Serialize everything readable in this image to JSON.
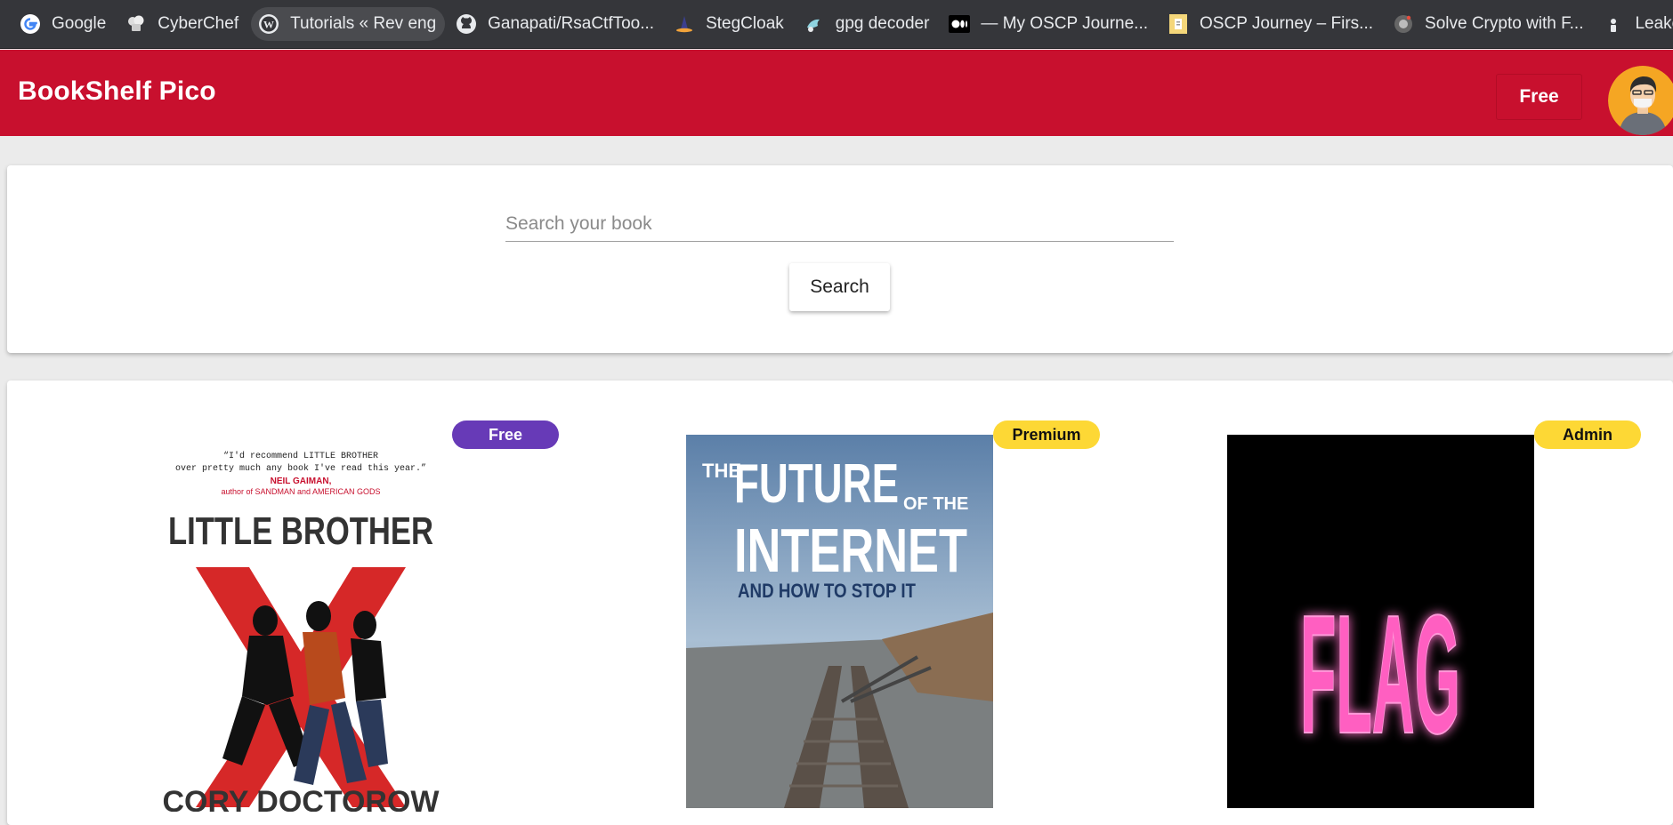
{
  "bookmarks": [
    {
      "label": "Google",
      "icon": "google-icon"
    },
    {
      "label": "CyberChef",
      "icon": "chef-hat-icon"
    },
    {
      "label": "Tutorials « Rev eng",
      "icon": "wordpress-icon"
    },
    {
      "label": "Ganapati/RsaCtfToo...",
      "icon": "github-icon"
    },
    {
      "label": "StegCloak",
      "icon": "stegcloak-icon"
    },
    {
      "label": "gpg decoder",
      "icon": "gpg-icon"
    },
    {
      "label": "— My OSCP Journe...",
      "icon": "medium-icon"
    },
    {
      "label": "OSCP Journey – Firs...",
      "icon": "doc-icon"
    },
    {
      "label": "Solve Crypto with F...",
      "icon": "crypto-icon"
    },
    {
      "label": "Leaked",
      "icon": "leaked-icon"
    }
  ],
  "header": {
    "brand": "BookShelf Pico",
    "plan_label": "Free",
    "color": "#c8102e"
  },
  "search": {
    "placeholder": "Search your book",
    "value": "",
    "button_label": "Search"
  },
  "books": [
    {
      "badge": "Free",
      "badge_color": "#673ab7",
      "cover": {
        "quote_line1": "“I'd recommend LITTLE BROTHER",
        "quote_line2": "over pretty much any book I've read this year.”",
        "quote_author": "NEIL GAIMAN,",
        "quote_credit": "author of SANDMAN and AMERICAN GODS",
        "title": "LITTLE BROTHER",
        "author": "CORY DOCTOROW"
      }
    },
    {
      "badge": "Premium",
      "badge_color": "#fdd835",
      "cover": {
        "title_the": "THE",
        "title_future": "FUTURE",
        "title_ofthe": "OF THE",
        "title_internet": "INTERNET",
        "subtitle": "AND HOW TO STOP IT"
      }
    },
    {
      "badge": "Admin",
      "badge_color": "#fdd835",
      "cover": {
        "title": "FLAG"
      }
    }
  ]
}
